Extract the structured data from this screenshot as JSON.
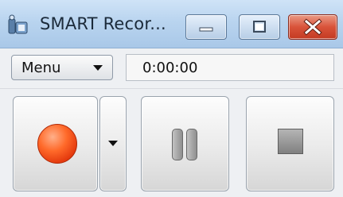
{
  "window": {
    "title": "SMART Recor...",
    "icons": {
      "app": "smart-recorder-app-icon",
      "minimize": "minimize-icon",
      "maximize": "maximize-icon",
      "close": "close-icon"
    },
    "colors": {
      "titlebar": "#b9d4ef",
      "close_button": "#d9533a",
      "record_dot": "#ff6a2a"
    }
  },
  "toolbar": {
    "menu_label": "Menu",
    "menu_icon": "chevron-down-icon",
    "elapsed_time": "0:00:00"
  },
  "controls": {
    "record_icon": "record-icon",
    "record_options_icon": "chevron-down-icon",
    "pause_icon": "pause-icon",
    "stop_icon": "stop-icon"
  }
}
